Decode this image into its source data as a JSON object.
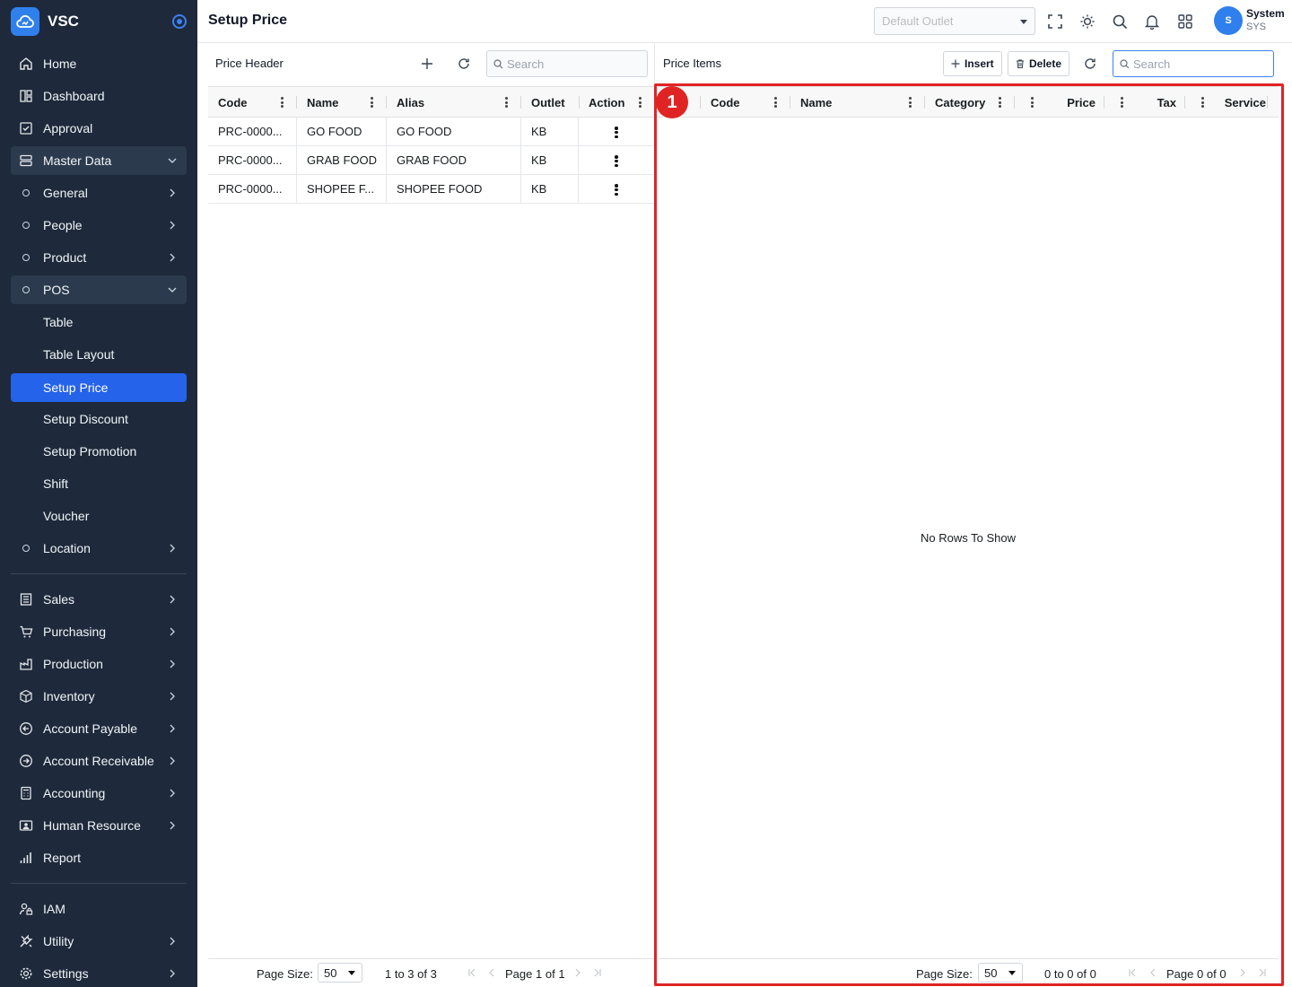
{
  "app": {
    "name": "VSC"
  },
  "sidebar": {
    "home": "Home",
    "dashboard": "Dashboard",
    "approval": "Approval",
    "master_data": "Master Data",
    "general": "General",
    "people": "People",
    "product": "Product",
    "pos": "POS",
    "pos_items": [
      "Table",
      "Table Layout",
      "Setup Price",
      "Setup Discount",
      "Setup Promotion",
      "Shift",
      "Voucher"
    ],
    "location": "Location",
    "modules": [
      "Sales",
      "Purchasing",
      "Production",
      "Inventory",
      "Account Payable",
      "Account Receivable",
      "Accounting",
      "Human Resource",
      "Report"
    ],
    "iam": "IAM",
    "utility": "Utility",
    "settings": "Settings"
  },
  "header": {
    "title": "Setup Price",
    "outlet_placeholder": "Default Outlet",
    "user_name": "System",
    "user_code": "SYS",
    "avatar_letter": "S"
  },
  "price_header": {
    "title": "Price Header",
    "search_placeholder": "Search",
    "columns": [
      "Code",
      "Name",
      "Alias",
      "Outlet",
      "Action"
    ],
    "rows": [
      {
        "code": "PRC-0000...",
        "name": "GO FOOD",
        "alias": "GO FOOD",
        "outlet": "KB"
      },
      {
        "code": "PRC-0000...",
        "name": "GRAB FOOD",
        "alias": "GRAB FOOD",
        "outlet": "KB"
      },
      {
        "code": "PRC-0000...",
        "name": "SHOPEE F...",
        "alias": "SHOPEE FOOD",
        "outlet": "KB"
      }
    ],
    "pager": {
      "page_size_label": "Page Size:",
      "page_size": "50",
      "range": "1 to 3 of 3",
      "page_word": "Page",
      "page_current": "1",
      "of_word": "of",
      "page_total": "1"
    }
  },
  "price_items": {
    "title": "Price Items",
    "insert_label": "Insert",
    "delete_label": "Delete",
    "search_placeholder": "Search",
    "columns": [
      "Code",
      "Name",
      "Category",
      "Price",
      "Tax",
      "Service"
    ],
    "empty_message": "No Rows To Show",
    "pager": {
      "page_size_label": "Page Size:",
      "page_size": "50",
      "range": "0 to 0 of 0",
      "page_word": "Page",
      "page_current": "0",
      "of_word": "of",
      "page_total": "0"
    }
  },
  "annotation": {
    "marker": "1",
    "color": "#e02424"
  },
  "colors": {
    "sidebar_bg": "#1e2a3b",
    "active": "#2563eb",
    "brand": "#2f80ed"
  }
}
